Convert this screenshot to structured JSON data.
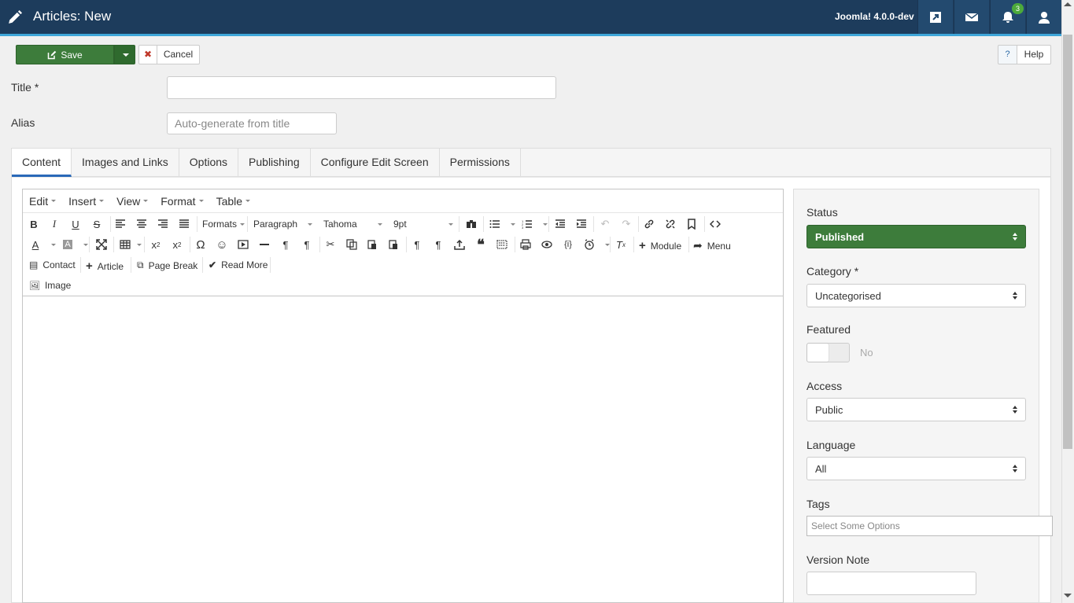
{
  "header": {
    "title": "Articles: New",
    "version": "Joomla! 4.0.0-dev",
    "notification_count": "3",
    "bg_color": "#1d3c5c"
  },
  "toolbar": {
    "save_label": "Save",
    "cancel_label": "Cancel",
    "help_q": "?",
    "help_label": "Help"
  },
  "form": {
    "title_label": "Title *",
    "title_value": "",
    "alias_label": "Alias",
    "alias_placeholder": "Auto-generate from title"
  },
  "tabs": [
    {
      "label": "Content"
    },
    {
      "label": "Images and Links"
    },
    {
      "label": "Options"
    },
    {
      "label": "Publishing"
    },
    {
      "label": "Configure Edit Screen"
    },
    {
      "label": "Permissions"
    }
  ],
  "editor": {
    "menus": [
      "Edit",
      "Insert",
      "View",
      "Format",
      "Table"
    ],
    "formats": "Formats",
    "block": "Paragraph",
    "font": "Tahoma",
    "size": "9pt",
    "module_label": "Module",
    "menu_label": "Menu",
    "contact_label": "Contact",
    "article_label": "Article",
    "pagebreak_label": "Page Break",
    "readmore_label": "Read More",
    "image_label": "Image"
  },
  "sidebar": {
    "status_label": "Status",
    "status_value": "Published",
    "status_color": "#3d7c3b",
    "category_label": "Category *",
    "category_value": "Uncategorised",
    "featured_label": "Featured",
    "featured_value": "No",
    "access_label": "Access",
    "access_value": "Public",
    "language_label": "Language",
    "language_value": "All",
    "tags_label": "Tags",
    "tags_placeholder": "Select Some Options",
    "version_label": "Version Note"
  }
}
